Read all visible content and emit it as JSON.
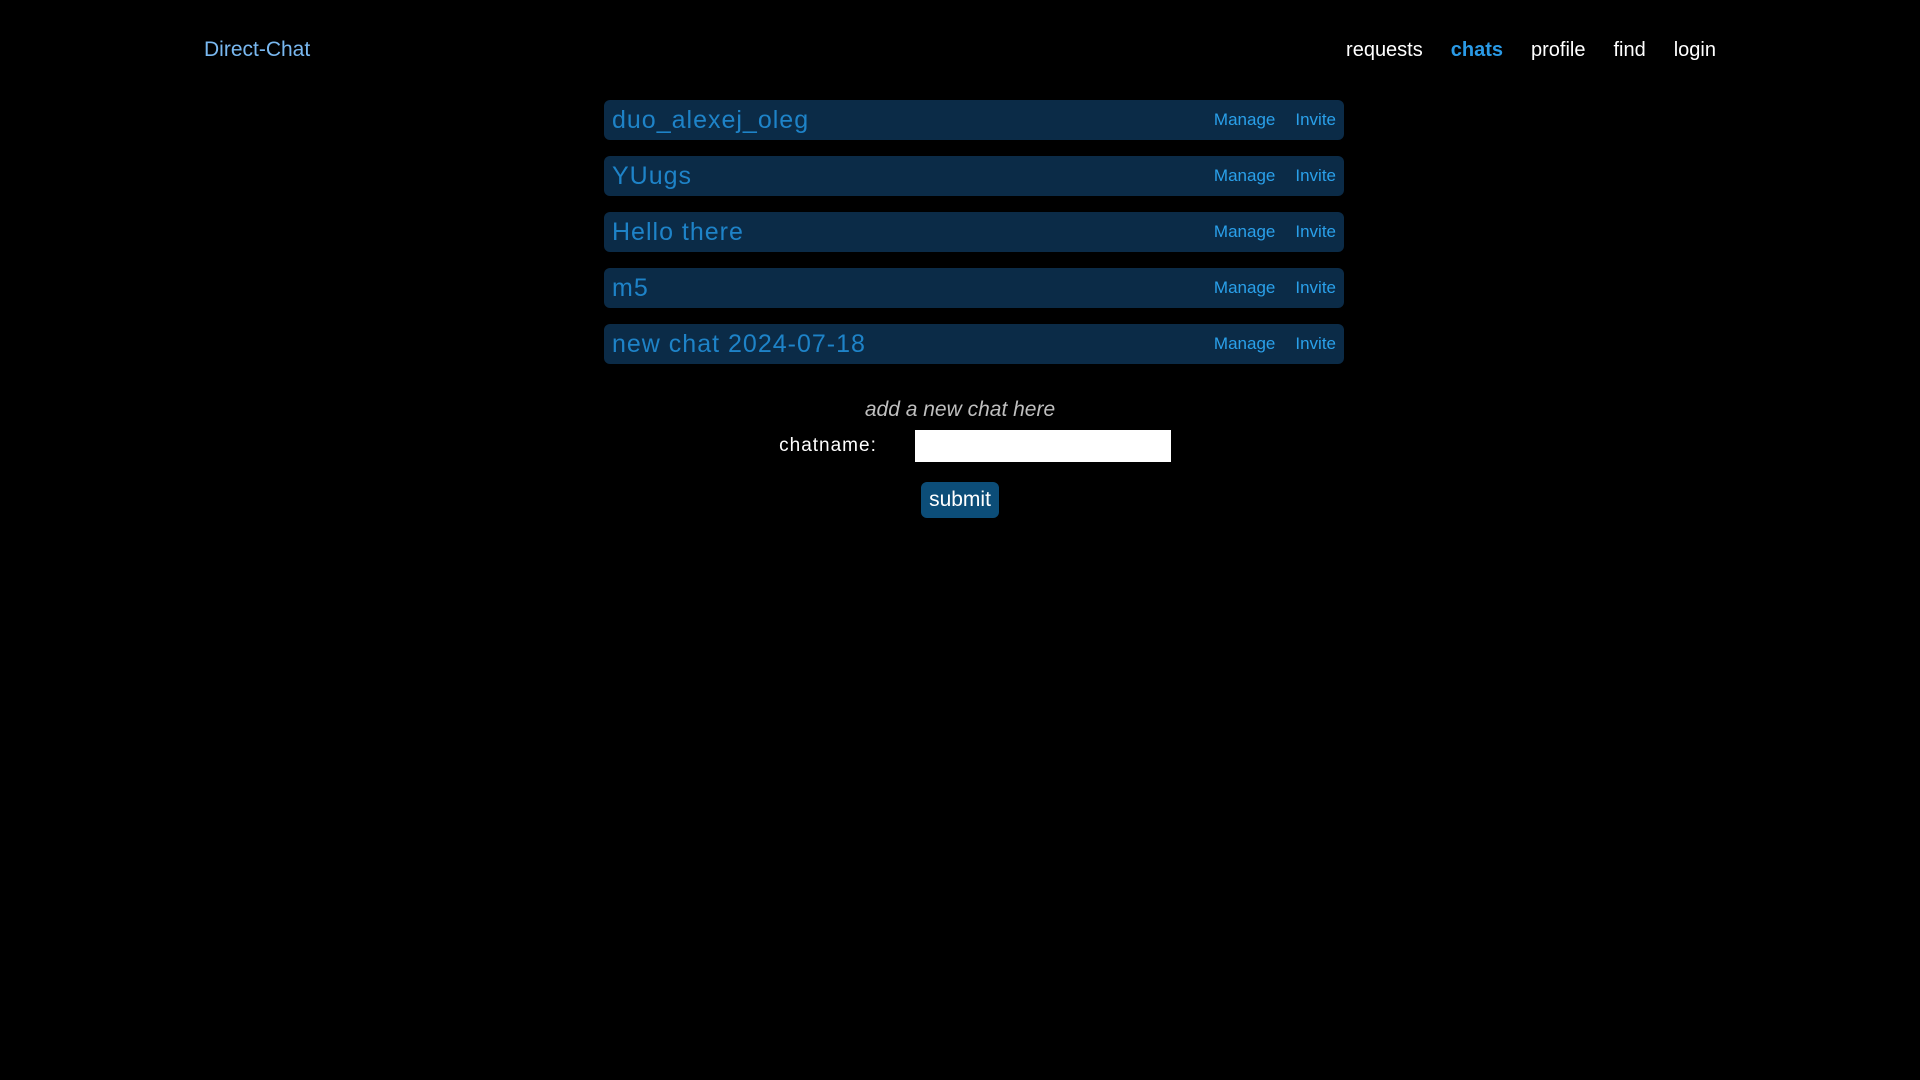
{
  "header": {
    "brand": "Direct-Chat",
    "nav": [
      {
        "label": "requests",
        "active": false
      },
      {
        "label": "chats",
        "active": true
      },
      {
        "label": "profile",
        "active": false
      },
      {
        "label": "find",
        "active": false
      },
      {
        "label": "login",
        "active": false
      }
    ]
  },
  "chats": [
    {
      "name": "duo_alexej_oleg",
      "manage_label": "Manage",
      "invite_label": "Invite"
    },
    {
      "name": "YUugs",
      "manage_label": "Manage",
      "invite_label": "Invite"
    },
    {
      "name": "Hello there",
      "manage_label": "Manage",
      "invite_label": "Invite"
    },
    {
      "name": "m5",
      "manage_label": "Manage",
      "invite_label": "Invite"
    },
    {
      "name": "new chat 2024-07-18",
      "manage_label": "Manage",
      "invite_label": "Invite"
    }
  ],
  "add_chat": {
    "hint": "add a new chat here",
    "field_label": "chatname:",
    "field_value": "",
    "submit_label": "submit"
  },
  "colors": {
    "background": "#000000",
    "brand": "#79b8f0",
    "nav_active": "#2a9ae6",
    "row_background": "#0b2b47",
    "chat_name": "#1e83c8",
    "action_link": "#2aa0ea",
    "submit_background": "#0c4d78"
  }
}
